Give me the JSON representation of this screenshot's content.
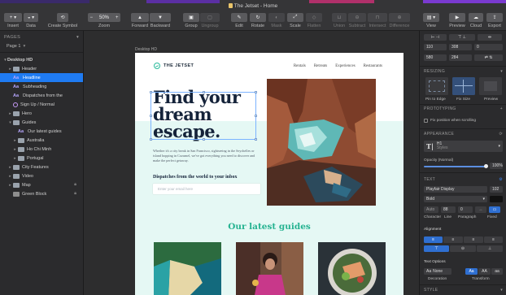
{
  "window": {
    "title": "The Jetset - Home"
  },
  "colors": {
    "toolbar_bg": "#353537",
    "sidebar_bg": "#2b2b2d",
    "selection": "#1f7bf2",
    "brand_green": "#26b391",
    "mint_bg": "#e5f8f4",
    "navy": "#15233a"
  },
  "toolbar": {
    "insert": "Insert",
    "data": "Data",
    "create_symbol": "Create Symbol",
    "zoom_value": "50%",
    "zoom": "Zoom",
    "forward": "Forward",
    "backward": "Backward",
    "group": "Group",
    "ungroup": "Ungroup",
    "edit": "Edit",
    "rotate": "Rotate",
    "mask": "Mask",
    "scale": "Scale",
    "flatten": "Flatten",
    "union": "Union",
    "subtract": "Subtract",
    "intersect": "Intersect",
    "difference": "Difference",
    "view": "View",
    "preview": "Preview",
    "cloud": "Cloud",
    "export": "Export"
  },
  "sidebar": {
    "pages_header": "PAGES",
    "current_page": "Page 1",
    "layers": [
      {
        "label": "Desktop HD",
        "icon": "artboard-icon",
        "indent": 0,
        "bold": true
      },
      {
        "label": "Header",
        "icon": "folder-icon",
        "indent": 1
      },
      {
        "label": "Headline",
        "icon": "text-icon",
        "indent": 1,
        "selected": true
      },
      {
        "label": "Subheading",
        "icon": "text-icon",
        "indent": 1
      },
      {
        "label": "Dispatches from the",
        "icon": "text-icon",
        "indent": 1
      },
      {
        "label": "Sign Up / Normal",
        "icon": "symbol-icon",
        "indent": 1
      },
      {
        "label": "Hero",
        "icon": "folder-icon",
        "indent": 1
      },
      {
        "label": "Guides",
        "icon": "folder-icon",
        "indent": 1,
        "open": true
      },
      {
        "label": "Our latest guides",
        "icon": "text-icon",
        "indent": 2
      },
      {
        "label": "Australia",
        "icon": "folder-icon",
        "indent": 2
      },
      {
        "label": "Ho Chi Minh",
        "icon": "folder-icon",
        "indent": 2
      },
      {
        "label": "Portugal",
        "icon": "folder-icon",
        "indent": 2
      },
      {
        "label": "City Features",
        "icon": "folder-icon",
        "indent": 1
      },
      {
        "label": "Video",
        "icon": "folder-icon",
        "indent": 1
      },
      {
        "label": "Map",
        "icon": "folder-icon",
        "indent": 1,
        "locked": true
      },
      {
        "label": "Green Block",
        "icon": "rect-icon",
        "indent": 1,
        "locked": true
      }
    ]
  },
  "canvas": {
    "artboard_name": "Desktop HD",
    "logo": "THE JETSET",
    "nav": [
      "Rentals",
      "Retreats",
      "Experiences",
      "Restaurants"
    ],
    "headline": "Find your dream escape.",
    "body_copy": "Whether it's a city break in San Francisco, sightseeing in the Seychelles or island hopping in Cozumel, we've got everything you need to discover and make the perfect getaway.",
    "dispatch_heading": "Dispatches from the world to your inbox",
    "email_placeholder": "Enter your email here",
    "guides_title": "Our latest guides"
  },
  "inspector": {
    "x": "110",
    "y": "308",
    "r": "0",
    "w": "580",
    "h": "284",
    "resizing": "RESIZING",
    "pin_to_edge": "Pin to Edge",
    "fix_size": "Fix Size",
    "preview": "Preview",
    "prototyping": "PROTOTYPING",
    "fix_position": "Fix position when scrolling",
    "appearance": "APPEARANCE",
    "style_name": "H1",
    "style_sub": "Styles",
    "opacity_label": "Opacity (Normal)",
    "opacity_value": "100%",
    "text": "TEXT",
    "font": "Playfair Display",
    "weight": "Bold",
    "font_size": "102",
    "character_value": "Auto",
    "line_value": "88",
    "paragraph_value": "0",
    "character": "Character",
    "line": "Line",
    "paragraph": "Paragraph",
    "fixed": "Fixed",
    "alignment": "Alignment",
    "text_options": "Text Options",
    "decoration": "None",
    "decoration_label": "Decoration",
    "transform_label": "Transform",
    "transform_options": [
      "Aa",
      "AA",
      "aa"
    ],
    "style": "STYLE"
  }
}
